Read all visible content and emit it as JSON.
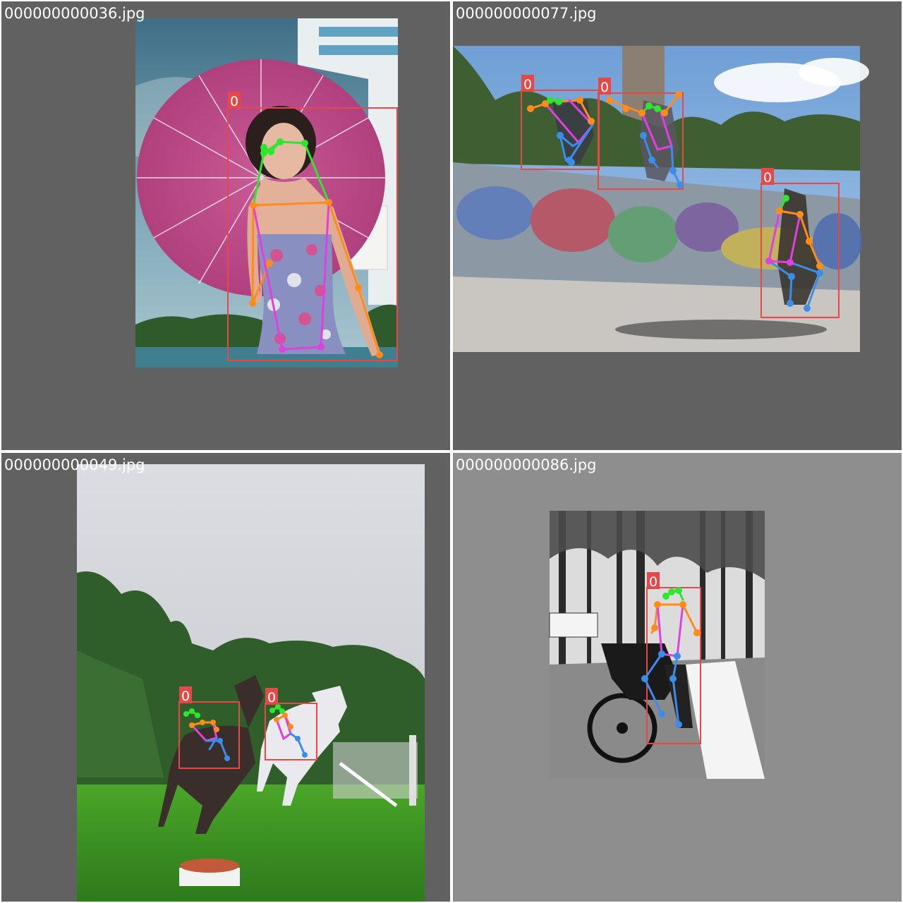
{
  "colors": {
    "box": "#e64848",
    "label_bg": "#e64848",
    "label_text": "#ffffff",
    "limb_face": "#2ee62e",
    "limb_arms": "#ff8c1a",
    "limb_torso": "#e040e0",
    "limb_legs": "#3a8eea",
    "tile_bg_dark": "#616161",
    "tile_bg_light": "#8e8e8e"
  },
  "tiles": [
    {
      "id": "tile-1",
      "filename": "000000000036.jpg",
      "detections": [
        {
          "class_label": "0"
        }
      ]
    },
    {
      "id": "tile-2",
      "filename": "000000000077.jpg",
      "detections": [
        {
          "class_label": "0"
        },
        {
          "class_label": "0"
        },
        {
          "class_label": "0"
        }
      ]
    },
    {
      "id": "tile-3",
      "filename": "000000000049.jpg",
      "detections": [
        {
          "class_label": "0"
        },
        {
          "class_label": "0"
        }
      ]
    },
    {
      "id": "tile-4",
      "filename": "000000000086.jpg",
      "detections": [
        {
          "class_label": "0"
        }
      ]
    }
  ]
}
